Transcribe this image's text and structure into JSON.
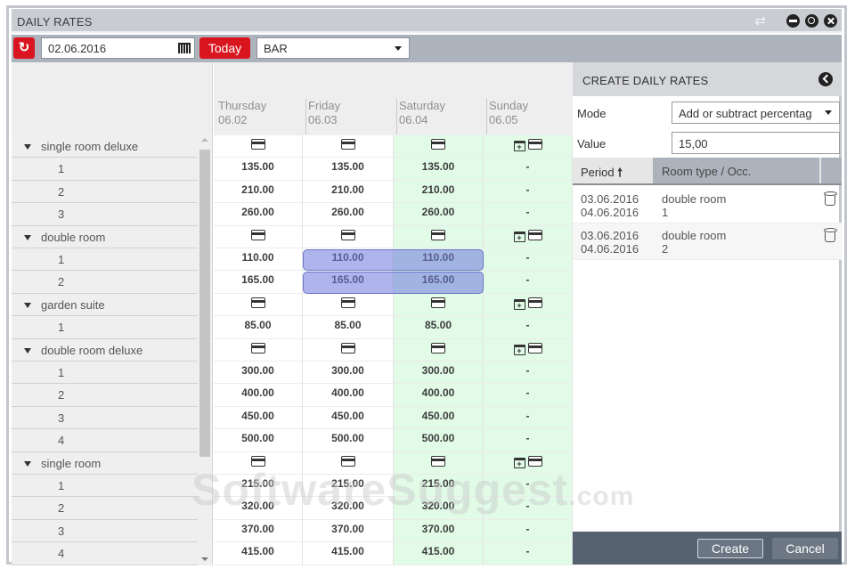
{
  "window": {
    "title": "DAILY RATES",
    "controls": [
      "swap-icon",
      "minimize-icon",
      "restore-icon",
      "close-icon"
    ]
  },
  "toolbar": {
    "refresh_icon": "refresh-icon",
    "date_value": "02.06.2016",
    "calendar_icon": "calendar-icon",
    "today_label": "Today",
    "rate_plan_value": "BAR"
  },
  "colors": {
    "accent_red": "#d9151f",
    "weekend_green": "#e1fbe6",
    "selection_blue": "#6e78dc",
    "footer_slate": "#566270"
  },
  "grid": {
    "days": [
      {
        "weekday": "Thursday",
        "date": "06.02",
        "weekend": false
      },
      {
        "weekday": "Friday",
        "date": "06.03",
        "weekend": false
      },
      {
        "weekday": "Saturday",
        "date": "06.04",
        "weekend": true
      },
      {
        "weekday": "Sunday",
        "date": "06.05",
        "weekend": true
      }
    ],
    "rooms": [
      {
        "name": "single room deluxe",
        "header_icons": [
          "rate-card",
          "rate-card",
          "rate-card",
          "calendar-plus+rate-card"
        ],
        "occupancies": [
          {
            "occ": "1",
            "rates": [
              "135.00",
              "135.00",
              "135.00",
              "-"
            ]
          },
          {
            "occ": "2",
            "rates": [
              "210.00",
              "210.00",
              "210.00",
              "-"
            ]
          },
          {
            "occ": "3",
            "rates": [
              "260.00",
              "260.00",
              "260.00",
              "-"
            ]
          }
        ]
      },
      {
        "name": "double room",
        "header_icons": [
          "rate-card",
          "rate-card",
          "rate-card",
          "calendar-plus+rate-card"
        ],
        "occupancies": [
          {
            "occ": "1",
            "rates": [
              "110.00",
              "110.00",
              "110.00",
              "-"
            ],
            "selected_days": [
              1,
              2
            ]
          },
          {
            "occ": "2",
            "rates": [
              "165.00",
              "165.00",
              "165.00",
              "-"
            ],
            "selected_days": [
              1,
              2
            ]
          }
        ]
      },
      {
        "name": "garden suite",
        "header_icons": [
          "rate-card",
          "rate-card",
          "rate-card",
          "calendar-plus+rate-card"
        ],
        "occupancies": [
          {
            "occ": "1",
            "rates": [
              "85.00",
              "85.00",
              "85.00",
              "-"
            ]
          }
        ]
      },
      {
        "name": "double room deluxe",
        "header_icons": [
          "rate-card",
          "rate-card",
          "rate-card",
          "calendar-plus+rate-card"
        ],
        "occupancies": [
          {
            "occ": "1",
            "rates": [
              "300.00",
              "300.00",
              "300.00",
              "-"
            ]
          },
          {
            "occ": "2",
            "rates": [
              "400.00",
              "400.00",
              "400.00",
              "-"
            ]
          },
          {
            "occ": "3",
            "rates": [
              "450.00",
              "450.00",
              "450.00",
              "-"
            ]
          },
          {
            "occ": "4",
            "rates": [
              "500.00",
              "500.00",
              "500.00",
              "-"
            ]
          }
        ]
      },
      {
        "name": "single room",
        "header_icons": [
          "rate-card",
          "rate-card",
          "rate-card",
          "calendar-plus+rate-card"
        ],
        "occupancies": [
          {
            "occ": "1",
            "rates": [
              "215.00",
              "215.00",
              "215.00",
              "-"
            ]
          },
          {
            "occ": "2",
            "rates": [
              "320.00",
              "320.00",
              "320.00",
              "-"
            ]
          },
          {
            "occ": "3",
            "rates": [
              "370.00",
              "370.00",
              "370.00",
              "-"
            ]
          },
          {
            "occ": "4",
            "rates": [
              "415.00",
              "415.00",
              "415.00",
              "-"
            ]
          }
        ]
      }
    ]
  },
  "panel": {
    "title": "CREATE DAILY RATES",
    "mode_label": "Mode",
    "mode_value": "Add or subtract percentag",
    "value_label": "Value",
    "value_value": "15,00",
    "list_headers": {
      "period": "Period",
      "room_type": "Room type / Occ."
    },
    "entries": [
      {
        "from": "03.06.2016",
        "to": "04.06.2016",
        "room": "double room",
        "occ": "1"
      },
      {
        "from": "03.06.2016",
        "to": "04.06.2016",
        "room": "double room",
        "occ": "2"
      }
    ],
    "create_label": "Create",
    "cancel_label": "Cancel"
  },
  "watermark": {
    "main": "SoftwareSuggest",
    "suffix": ".com"
  }
}
